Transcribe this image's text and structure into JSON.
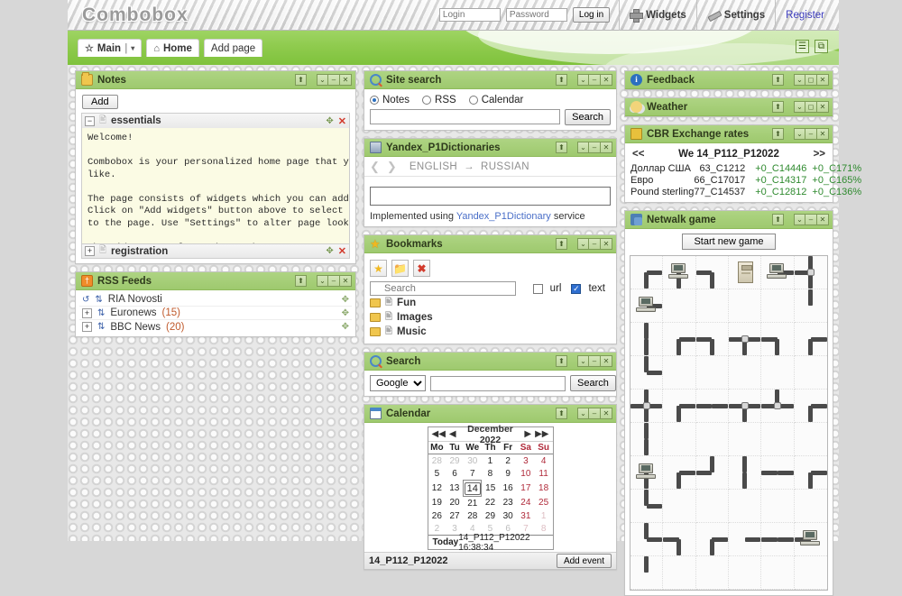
{
  "app": {
    "logo": "Combobox"
  },
  "topbar": {
    "login_placeholder": "Login",
    "password_placeholder": "Password",
    "login_button": "Log in",
    "widgets_label": "Widgets",
    "settings_label": "Settings",
    "register_label": "Register"
  },
  "nav": {
    "main_tab": "Main",
    "main_divider": "|",
    "main_caret": "▾",
    "home_tab": "Home",
    "add_page": "Add page",
    "page_controls": [
      "☰",
      "⧉"
    ]
  },
  "widget_controls": {
    "refresh": "⬆",
    "collapse": "⌄",
    "minimize": "–",
    "close": "✕"
  },
  "notes": {
    "title": "Notes",
    "add_label": "Add",
    "item1": "essentials",
    "item1_expander": "−",
    "item2": "registration",
    "item2_expander": "+",
    "text": "Welcome!\n\nCombobox is your personalized home page that you can tune up as you\nlike.\n\nThe page consists of widgets which you can add, move and delete.\nClick on \"Add widgets\" button above to select new widget and add it\nto the page. Use \"Settings\" to alter page look and feel.\n\nThe widgets are located on tabs. You can group widgets on different\ntabs to organize them by purpose.\n\nThe layout of widgets on each tab can be configured in tab"
  },
  "rss": {
    "title": "RSS Feeds",
    "feeds": [
      {
        "name": "RIA Novosti",
        "count": "",
        "loading": true
      },
      {
        "name": "Euronews",
        "count": "(15)",
        "loading": false
      },
      {
        "name": "BBC News",
        "count": "(20)",
        "loading": false
      }
    ]
  },
  "site_search": {
    "title": "Site search",
    "options": [
      "Notes",
      "RSS",
      "Calendar"
    ],
    "selected": "Notes",
    "query": "",
    "button": "Search"
  },
  "dictionary": {
    "title": "Yandex_P1Dictionaries",
    "prev": "❮",
    "next": "❯",
    "from": "ENGLISH",
    "arrow": "→",
    "to": "RUSSIAN",
    "query": "",
    "footer_pre": "Implemented using ",
    "footer_link": "Yandex_P1Dictionary",
    "footer_post": " service"
  },
  "bookmarks": {
    "title": "Bookmarks",
    "tools": [
      "add-bookmark",
      "add-folder",
      "delete"
    ],
    "search_placeholder": "Search",
    "url_label": "url",
    "url_checked": false,
    "text_label": "text",
    "text_checked": true,
    "folders": [
      "Fun",
      "Images",
      "Music"
    ]
  },
  "search": {
    "title": "Search",
    "engine": "Google",
    "engines": [
      "Google"
    ],
    "query": "",
    "button": "Search"
  },
  "calendar": {
    "title": "Calendar",
    "first": "◀◀",
    "prev": "◀",
    "month": "December 2022",
    "next": "▶",
    "last": "▶▶",
    "weekdays": [
      "Mo",
      "Tu",
      "We",
      "Th",
      "Fr",
      "Sa",
      "Su"
    ],
    "weeks": [
      [
        {
          "d": "28",
          "o": true
        },
        {
          "d": "29",
          "o": true
        },
        {
          "d": "30",
          "o": true
        },
        {
          "d": "1"
        },
        {
          "d": "2"
        },
        {
          "d": "3",
          "w": true
        },
        {
          "d": "4",
          "w": true
        }
      ],
      [
        {
          "d": "5"
        },
        {
          "d": "6"
        },
        {
          "d": "7"
        },
        {
          "d": "8"
        },
        {
          "d": "9"
        },
        {
          "d": "10",
          "w": true
        },
        {
          "d": "11",
          "w": true
        }
      ],
      [
        {
          "d": "12"
        },
        {
          "d": "13"
        },
        {
          "d": "14",
          "s": true
        },
        {
          "d": "15"
        },
        {
          "d": "16"
        },
        {
          "d": "17",
          "w": true
        },
        {
          "d": "18",
          "w": true
        }
      ],
      [
        {
          "d": "19"
        },
        {
          "d": "20"
        },
        {
          "d": "21"
        },
        {
          "d": "22"
        },
        {
          "d": "23"
        },
        {
          "d": "24",
          "w": true
        },
        {
          "d": "25",
          "w": true
        }
      ],
      [
        {
          "d": "26"
        },
        {
          "d": "27"
        },
        {
          "d": "28"
        },
        {
          "d": "29"
        },
        {
          "d": "30"
        },
        {
          "d": "31",
          "w": true
        },
        {
          "d": "1",
          "o": true,
          "w": true
        }
      ],
      [
        {
          "d": "2",
          "o": true
        },
        {
          "d": "3",
          "o": true
        },
        {
          "d": "4",
          "o": true
        },
        {
          "d": "5",
          "o": true
        },
        {
          "d": "6",
          "o": true
        },
        {
          "d": "7",
          "o": true,
          "w": true
        },
        {
          "d": "8",
          "o": true,
          "w": true
        }
      ]
    ],
    "today_label": "Today",
    "timestamp": "14_P112_P12022 16:38:34",
    "event_date": "14_P112_P12022",
    "add_event": "Add event"
  },
  "feedback": {
    "title": "Feedback"
  },
  "weather": {
    "title": "Weather"
  },
  "exchange": {
    "title": "CBR Exchange rates",
    "prev": "<<",
    "next": ">>",
    "date": "We 14_P112_P12022",
    "rows": [
      {
        "name": "Доллар США",
        "rate": "63_C1212",
        "delta": "+0_C14446",
        "pct": "+0_C171%"
      },
      {
        "name": "Евро",
        "rate": "66_C17017",
        "delta": "+0_C14317",
        "pct": "+0_C165%"
      },
      {
        "name": "Pound sterling",
        "rate": "77_C14537",
        "delta": "+0_C12812",
        "pct": "+0_C136%"
      }
    ]
  },
  "netwalk": {
    "title": "Netwalk game",
    "start_button": "Start new game",
    "cells": [
      {
        "p": [
          "d",
          "r"
        ]
      },
      {
        "t": "computer",
        "p": [
          "d"
        ]
      },
      {
        "p": [
          "d",
          "l"
        ]
      },
      {
        "t": "server"
      },
      {
        "t": "computer",
        "p": [
          "r"
        ]
      },
      {
        "p": [
          "u",
          "d",
          "l"
        ]
      },
      {
        "t": "computer",
        "p": [
          "r"
        ]
      },
      {
        "p": []
      },
      {
        "p": []
      },
      {
        "p": []
      },
      {
        "p": []
      },
      {
        "p": [
          "u"
        ]
      },
      {
        "p": [
          "u",
          "d"
        ]
      },
      {
        "p": [
          "d",
          "r"
        ]
      },
      {
        "p": [
          "d",
          "l"
        ]
      },
      {
        "p": [
          "l",
          "r",
          "d"
        ]
      },
      {
        "p": [
          "d",
          "l"
        ]
      },
      {
        "p": [
          "d",
          "r"
        ]
      },
      {
        "p": [
          "u",
          "r"
        ]
      },
      {
        "p": []
      },
      {
        "p": []
      },
      {
        "p": []
      },
      {
        "p": []
      },
      {
        "p": []
      },
      {
        "p": [
          "u",
          "d",
          "l",
          "r"
        ]
      },
      {
        "p": [
          "d",
          "r"
        ]
      },
      {
        "p": [
          "l",
          "r"
        ]
      },
      {
        "p": [
          "l",
          "r",
          "d"
        ]
      },
      {
        "p": [
          "u",
          "l",
          "r"
        ]
      },
      {
        "p": [
          "d",
          "r"
        ]
      },
      {
        "p": [
          "u",
          "d"
        ]
      },
      {
        "p": []
      },
      {
        "p": []
      },
      {
        "p": []
      },
      {
        "p": []
      },
      {
        "p": []
      },
      {
        "t": "computer",
        "p": [
          "d"
        ]
      },
      {
        "p": [
          "d",
          "r"
        ]
      },
      {
        "p": [
          "u",
          "l"
        ]
      },
      {
        "p": [
          "u",
          "d"
        ]
      },
      {
        "p": [
          "l",
          "r"
        ]
      },
      {
        "p": [
          "d",
          "r"
        ]
      },
      {
        "p": [
          "u",
          "r"
        ]
      },
      {
        "p": []
      },
      {
        "p": []
      },
      {
        "p": []
      },
      {
        "p": []
      },
      {
        "p": []
      },
      {
        "p": [
          "u",
          "r"
        ]
      },
      {
        "p": [
          "l",
          "d"
        ]
      },
      {
        "p": [
          "d",
          "r"
        ]
      },
      {
        "p": [
          "r"
        ]
      },
      {
        "p": [
          "l",
          "r"
        ]
      },
      {
        "t": "computer",
        "p": [
          "l"
        ]
      },
      {
        "p": [
          "u"
        ]
      },
      {
        "p": []
      },
      {
        "p": []
      },
      {
        "p": []
      },
      {
        "p": []
      },
      {
        "p": []
      }
    ]
  }
}
